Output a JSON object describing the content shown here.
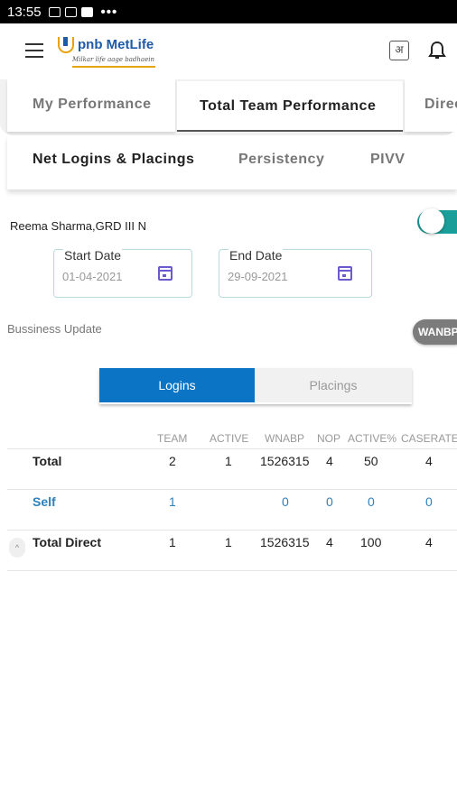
{
  "status_bar": {
    "time": "13:55",
    "icons": [
      "image-icon",
      "gallery-icon",
      "youtube-icon"
    ],
    "more": "•••"
  },
  "header": {
    "logo_text": "pnb MetLife",
    "logo_tagline": "Milkar life aage badhaein",
    "language_icon_glyph": "अ",
    "icons": [
      "menu-icon",
      "language-icon",
      "bell-icon"
    ]
  },
  "tabs": [
    {
      "label": "My Performance"
    },
    {
      "label": "Total Team Performance",
      "active": true
    },
    {
      "label": "Direc"
    }
  ],
  "subtabs": [
    {
      "label": "Net Logins & Placings",
      "active": true
    },
    {
      "label": "Persistency"
    },
    {
      "label": "PIVV"
    }
  ],
  "agent": {
    "name": "Reema Sharma,GRD III N"
  },
  "toggle": {
    "on": true,
    "color": "#1a9e9a"
  },
  "dates": {
    "start": {
      "label": "Start Date",
      "value": "01-04-2021"
    },
    "end": {
      "label": "End Date",
      "value": "29-09-2021"
    }
  },
  "business_update": {
    "label": "Bussiness Update",
    "metric_chip": "WANBP"
  },
  "segment": {
    "options": [
      {
        "label": "Logins",
        "active": true
      },
      {
        "label": "Placings"
      }
    ]
  },
  "table": {
    "columns": [
      "TEAM",
      "ACTIVE",
      "WNABP",
      "NOP",
      "ACTIVE%",
      "CASERATE"
    ],
    "rows": [
      {
        "label": "Total",
        "team": "2",
        "active": "1",
        "wnabp": "1526315",
        "nop": "4",
        "active_pct": "50",
        "caserate": "4"
      },
      {
        "label": "Self",
        "team": "1",
        "active": "",
        "wnabp": "0",
        "nop": "0",
        "active_pct": "0",
        "caserate": "0"
      },
      {
        "label": "Total Direct",
        "team": "1",
        "active": "1",
        "wnabp": "1526315",
        "nop": "4",
        "active_pct": "100",
        "caserate": "4",
        "expand_glyph": "^"
      }
    ]
  },
  "colors": {
    "accent": "#0b74c4",
    "teal": "#1a9e9a",
    "link": "#2f7fb8",
    "brand_yellow": "#e8a20a"
  }
}
